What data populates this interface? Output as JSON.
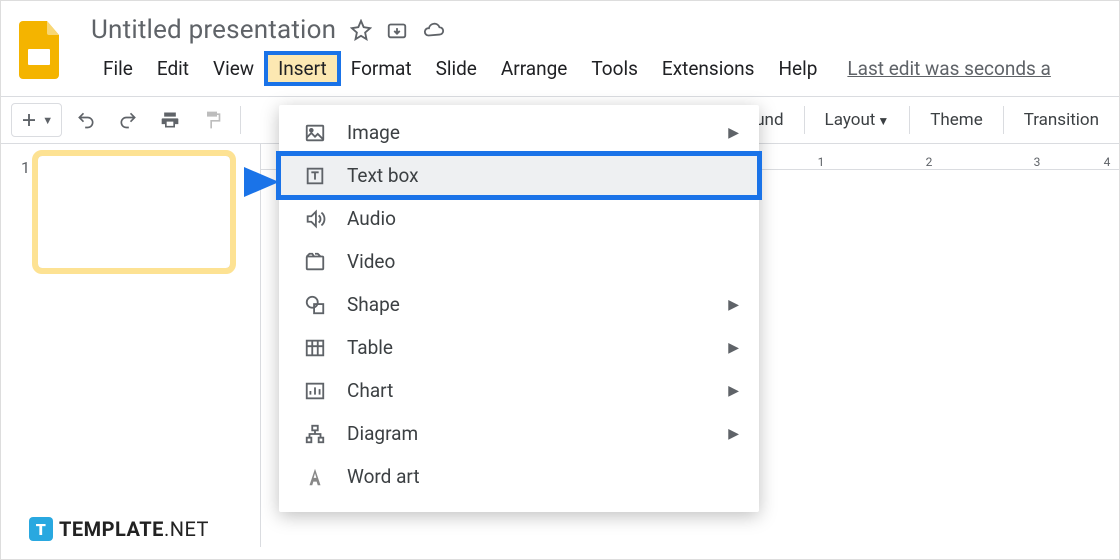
{
  "header": {
    "title": "Untitled presentation",
    "last_edit": "Last edit was seconds a"
  },
  "menubar": [
    "File",
    "Edit",
    "View",
    "Insert",
    "Format",
    "Slide",
    "Arrange",
    "Tools",
    "Extensions",
    "Help"
  ],
  "menubar_active_index": 3,
  "toolbar": {
    "background_partial": "und",
    "layout": "Layout",
    "theme": "Theme",
    "transition": "Transition"
  },
  "slide_panel": {
    "thumb_number": "1"
  },
  "ruler_labels": [
    "1",
    "2",
    "3",
    "4"
  ],
  "dropdown": {
    "items": [
      {
        "icon": "image-icon",
        "label": "Image",
        "submenu": true
      },
      {
        "icon": "textbox-icon",
        "label": "Text box",
        "submenu": false,
        "highlight": true
      },
      {
        "icon": "audio-icon",
        "label": "Audio",
        "submenu": false
      },
      {
        "icon": "video-icon",
        "label": "Video",
        "submenu": false
      },
      {
        "icon": "shape-icon",
        "label": "Shape",
        "submenu": true
      },
      {
        "icon": "table-icon",
        "label": "Table",
        "submenu": true
      },
      {
        "icon": "chart-icon",
        "label": "Chart",
        "submenu": true
      },
      {
        "icon": "diagram-icon",
        "label": "Diagram",
        "submenu": true
      },
      {
        "icon": "wordart-icon",
        "label": "Word art",
        "submenu": false
      }
    ]
  },
  "watermark": {
    "brand": "TEMPLATE",
    "suffix": ".NET",
    "badge": "T"
  }
}
